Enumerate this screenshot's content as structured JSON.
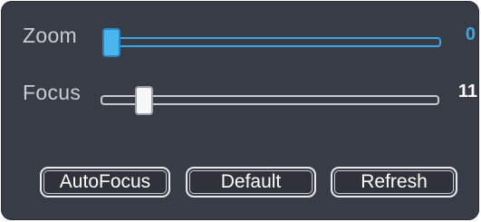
{
  "zoom": {
    "label": "Zoom",
    "value": "0",
    "value_color": "#3ba6e6",
    "level": 0
  },
  "focus": {
    "label": "Focus",
    "value": "11",
    "value_color": "#ffffff",
    "level": 11
  },
  "buttons": {
    "autofocus": "AutoFocus",
    "default": "Default",
    "refresh": "Refresh"
  },
  "colors": {
    "panel": "#383c46",
    "accent": "#3ba6e6",
    "text": "#c9ccd2"
  }
}
